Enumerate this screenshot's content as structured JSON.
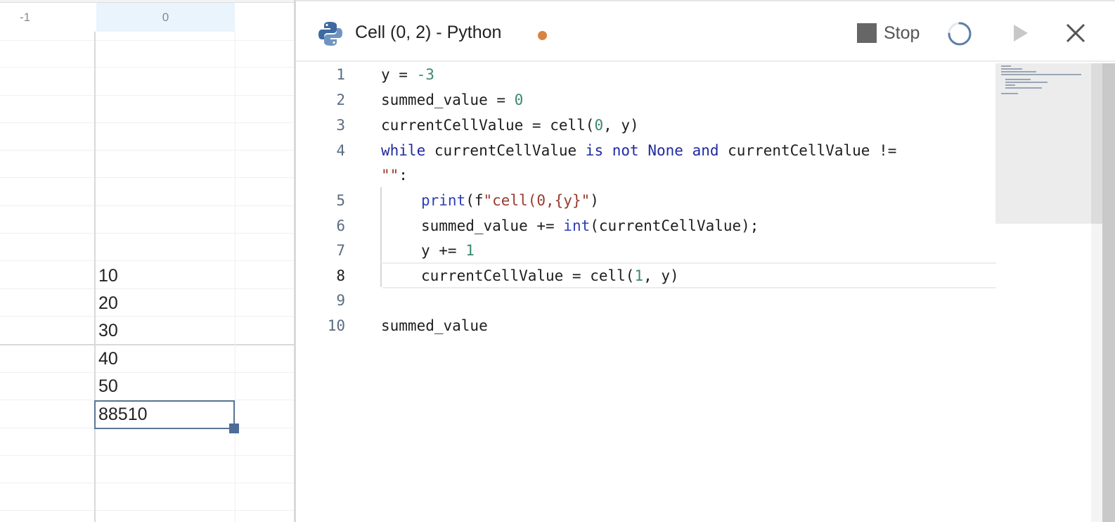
{
  "grid": {
    "column_headers": [
      "-1",
      "0"
    ],
    "cells": [
      "10",
      "20",
      "30",
      "40",
      "50",
      "88510"
    ],
    "selected_cell_value": "88510"
  },
  "editor": {
    "title": "Cell (0, 2) - Python",
    "stop_label": "Stop",
    "icons": {
      "language": "python-icon",
      "unsaved": "unsaved-dot",
      "stop": "stop-icon",
      "spinner": "loading-spinner-icon",
      "run": "play-icon",
      "close": "close-icon"
    },
    "line_numbers": [
      "1",
      "2",
      "3",
      "4",
      "5",
      "6",
      "7",
      "8",
      "9",
      "10"
    ],
    "active_line": "8",
    "code_lines": [
      "y = -3",
      "summed_value = 0",
      "currentCellValue = cell(0, y)",
      "while currentCellValue is not None and currentCellValue !=",
      "\"\":",
      "print(f\"cell(0,{y}\")",
      "summed_value += int(currentCellValue);",
      "y += 1",
      "currentCellValue = cell(1, y)",
      "",
      "summed_value"
    ]
  },
  "colors": {
    "accent": "#5a7598",
    "header_highlight": "#e9f4fc",
    "unsaved_dot": "#d98341",
    "keyword": "#1f2aa0",
    "number": "#3c8a6b",
    "string": "#9b3a2e"
  }
}
